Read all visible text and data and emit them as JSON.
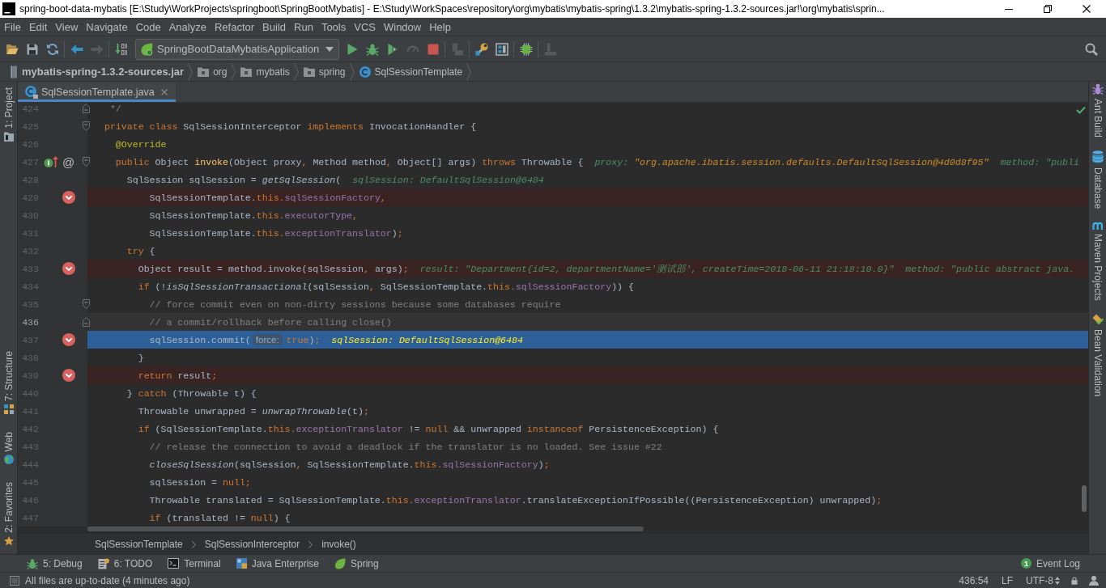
{
  "window": {
    "title": "spring-boot-data-mybatis [E:\\Study\\WorkProjects\\springboot\\SpringBootMybatis] - E:\\Study\\WorkSpaces\\repository\\org\\mybatis\\mybatis-spring\\1.3.2\\mybatis-spring-1.3.2-sources.jar!\\org\\mybatis\\sprin..."
  },
  "menu": [
    "File",
    "Edit",
    "View",
    "Navigate",
    "Code",
    "Analyze",
    "Refactor",
    "Build",
    "Run",
    "Tools",
    "VCS",
    "Window",
    "Help"
  ],
  "toolbar": {
    "run_configuration": "SpringBootDataMybatisApplication"
  },
  "navigation_bar": [
    {
      "label": "mybatis-spring-1.3.2-sources.jar",
      "kind": "jar"
    },
    {
      "label": "org",
      "kind": "package"
    },
    {
      "label": "mybatis",
      "kind": "package"
    },
    {
      "label": "spring",
      "kind": "package"
    },
    {
      "label": "SqlSessionTemplate",
      "kind": "class"
    }
  ],
  "left_strip": {
    "top": [
      {
        "label": "1: Project",
        "kind": "project"
      }
    ],
    "bottom": [
      {
        "label": "7: Structure",
        "kind": "structure"
      },
      {
        "label": "Web",
        "kind": "web"
      },
      {
        "label": "2: Favorites",
        "kind": "favorites"
      }
    ]
  },
  "right_strip": [
    {
      "label": "Ant Build",
      "kind": "ant"
    },
    {
      "label": "Database",
      "kind": "database"
    },
    {
      "label": "Maven Projects",
      "kind": "maven"
    },
    {
      "label": "Bean Validation",
      "kind": "bean"
    }
  ],
  "editor_tabs": [
    {
      "label": "SqlSessionTemplate.java",
      "selected": true
    }
  ],
  "editor": {
    "lines": [
      {
        "number": "424",
        "breakpoint": false,
        "current": false,
        "caret": false,
        "fold": {
          "kind": "end"
        },
        "code": [
          {
            "kind": "comment",
            "text": "   */"
          }
        ]
      },
      {
        "number": "425",
        "breakpoint": false,
        "current": false,
        "caret": false,
        "fold": {
          "kind": "start"
        },
        "code": [
          {
            "kind": "keyword",
            "text": "  private class"
          },
          {
            "kind": "plain",
            "text": " SqlSessionInterceptor "
          },
          {
            "kind": "keyword",
            "text": "implements"
          },
          {
            "kind": "plain",
            "text": " InvocationHandler {"
          }
        ]
      },
      {
        "number": "426",
        "breakpoint": false,
        "current": false,
        "caret": false,
        "code": [
          {
            "kind": "annotation",
            "text": "    @Override"
          }
        ]
      },
      {
        "number": "427",
        "breakpoint": false,
        "current": false,
        "caret": false,
        "fold": {
          "kind": "start"
        },
        "gutter_icon": {
          "kind": "implements"
        },
        "gutter_glyph": "@",
        "code": [
          {
            "kind": "keyword",
            "text": "    public"
          },
          {
            "kind": "plain",
            "text": " Object "
          },
          {
            "kind": "declaration",
            "text": "invoke"
          },
          {
            "kind": "plain",
            "text": "(Object proxy"
          },
          {
            "kind": "keyword",
            "text": ","
          },
          {
            "kind": "plain",
            "text": " Method method"
          },
          {
            "kind": "keyword",
            "text": ","
          },
          {
            "kind": "plain",
            "text": " Object[] args) "
          },
          {
            "kind": "keyword",
            "text": "throws"
          },
          {
            "kind": "plain",
            "text": " Throwable {"
          }
        ],
        "inline_values": [
          {
            "label": "proxy:",
            "value": "\"org.apache.ibatis.session.defaults.DefaultSqlSession@4d0d8f95\"",
            "changed": true
          },
          {
            "label": "method:",
            "value": "\"publi",
            "changed": false
          }
        ]
      },
      {
        "number": "428",
        "breakpoint": false,
        "current": false,
        "caret": false,
        "code": [
          {
            "kind": "plain",
            "text": "      SqlSession sqlSession = "
          },
          {
            "kind": "static",
            "text": "getSqlSession"
          },
          {
            "kind": "plain",
            "text": "("
          }
        ],
        "inline_values": [
          {
            "label": "sqlSession:",
            "value": "DefaultSqlSession@6484",
            "changed": false
          }
        ]
      },
      {
        "number": "429",
        "breakpoint": true,
        "current": false,
        "caret": false,
        "code": [
          {
            "kind": "plain",
            "text": "          SqlSessionTemplate."
          },
          {
            "kind": "keyword",
            "text": "this."
          },
          {
            "kind": "field",
            "text": "sqlSessionFactory"
          },
          {
            "kind": "keyword",
            "text": ","
          }
        ]
      },
      {
        "number": "430",
        "breakpoint": false,
        "current": false,
        "caret": false,
        "code": [
          {
            "kind": "plain",
            "text": "          SqlSessionTemplate."
          },
          {
            "kind": "keyword",
            "text": "this."
          },
          {
            "kind": "field",
            "text": "executorType"
          },
          {
            "kind": "keyword",
            "text": ","
          }
        ]
      },
      {
        "number": "431",
        "breakpoint": false,
        "current": false,
        "caret": false,
        "code": [
          {
            "kind": "plain",
            "text": "          SqlSessionTemplate."
          },
          {
            "kind": "keyword",
            "text": "this."
          },
          {
            "kind": "field",
            "text": "exceptionTranslator"
          },
          {
            "kind": "plain",
            "text": ")"
          },
          {
            "kind": "keyword",
            "text": ";"
          }
        ]
      },
      {
        "number": "432",
        "breakpoint": false,
        "current": false,
        "caret": false,
        "code": [
          {
            "kind": "keyword",
            "text": "      try"
          },
          {
            "kind": "plain",
            "text": " {"
          }
        ]
      },
      {
        "number": "433",
        "breakpoint": true,
        "current": false,
        "caret": false,
        "code": [
          {
            "kind": "plain",
            "text": "        Object result = method.invoke(sqlSession"
          },
          {
            "kind": "keyword",
            "text": ","
          },
          {
            "kind": "plain",
            "text": " args)"
          },
          {
            "kind": "keyword",
            "text": ";"
          }
        ],
        "inline_values": [
          {
            "label": "result:",
            "value": "\"Department{id=2, departmentName='测试部', createTime=2018-06-11 21:18:10.0}\"",
            "changed": false
          },
          {
            "label": "method:",
            "value": "\"public abstract java.",
            "changed": false
          }
        ]
      },
      {
        "number": "434",
        "breakpoint": false,
        "current": false,
        "caret": false,
        "code": [
          {
            "kind": "keyword",
            "text": "        if"
          },
          {
            "kind": "plain",
            "text": " (!"
          },
          {
            "kind": "static",
            "text": "isSqlSessionTransactional"
          },
          {
            "kind": "plain",
            "text": "(sqlSession"
          },
          {
            "kind": "keyword",
            "text": ","
          },
          {
            "kind": "plain",
            "text": " SqlSessionTemplate."
          },
          {
            "kind": "keyword",
            "text": "this."
          },
          {
            "kind": "field",
            "text": "sqlSessionFactory"
          },
          {
            "kind": "plain",
            "text": ")) {"
          }
        ]
      },
      {
        "number": "435",
        "breakpoint": false,
        "current": false,
        "caret": false,
        "fold": {
          "kind": "start"
        },
        "code": [
          {
            "kind": "comment",
            "text": "          // force commit even on non-dirty sessions because some databases require"
          }
        ]
      },
      {
        "number": "436",
        "breakpoint": false,
        "current": false,
        "caret": true,
        "fold": {
          "kind": "end"
        },
        "code": [
          {
            "kind": "comment",
            "text": "          // a commit/rollback before calling close()"
          }
        ]
      },
      {
        "number": "437",
        "breakpoint": true,
        "current": true,
        "caret": false,
        "code": [
          {
            "kind": "plain",
            "text": "          sqlSession.commit("
          },
          {
            "kind": "param-hint",
            "text": "force:"
          },
          {
            "kind": "keyword",
            "text": "true"
          },
          {
            "kind": "plain",
            "text": ")"
          },
          {
            "kind": "keyword",
            "text": ";"
          }
        ],
        "inline_values": [
          {
            "label": "sqlSession:",
            "value": "DefaultSqlSession@6484",
            "changed": false
          }
        ]
      },
      {
        "number": "438",
        "breakpoint": false,
        "current": false,
        "caret": false,
        "code": [
          {
            "kind": "plain",
            "text": "        }"
          }
        ]
      },
      {
        "number": "439",
        "breakpoint": true,
        "current": false,
        "caret": false,
        "code": [
          {
            "kind": "keyword",
            "text": "        return"
          },
          {
            "kind": "plain",
            "text": " result"
          },
          {
            "kind": "keyword",
            "text": ";"
          }
        ]
      },
      {
        "number": "440",
        "breakpoint": false,
        "current": false,
        "caret": false,
        "code": [
          {
            "kind": "plain",
            "text": "      } "
          },
          {
            "kind": "keyword",
            "text": "catch"
          },
          {
            "kind": "plain",
            "text": " (Throwable t) {"
          }
        ]
      },
      {
        "number": "441",
        "breakpoint": false,
        "current": false,
        "caret": false,
        "code": [
          {
            "kind": "plain",
            "text": "        Throwable unwrapped = "
          },
          {
            "kind": "static",
            "text": "unwrapThrowable"
          },
          {
            "kind": "plain",
            "text": "(t)"
          },
          {
            "kind": "keyword",
            "text": ";"
          }
        ]
      },
      {
        "number": "442",
        "breakpoint": false,
        "current": false,
        "caret": false,
        "code": [
          {
            "kind": "keyword",
            "text": "        if"
          },
          {
            "kind": "plain",
            "text": " (SqlSessionTemplate."
          },
          {
            "kind": "keyword",
            "text": "this."
          },
          {
            "kind": "field",
            "text": "exceptionTranslator"
          },
          {
            "kind": "plain",
            "text": " != "
          },
          {
            "kind": "keyword",
            "text": "null"
          },
          {
            "kind": "plain",
            "text": " && unwrapped "
          },
          {
            "kind": "keyword",
            "text": "instanceof"
          },
          {
            "kind": "plain",
            "text": " PersistenceException) {"
          }
        ]
      },
      {
        "number": "443",
        "breakpoint": false,
        "current": false,
        "caret": false,
        "code": [
          {
            "kind": "comment",
            "text": "          // release the connection to avoid a deadlock if the translator is no loaded. See issue #22"
          }
        ]
      },
      {
        "number": "444",
        "breakpoint": false,
        "current": false,
        "caret": false,
        "code": [
          {
            "kind": "static",
            "text": "          closeSqlSession"
          },
          {
            "kind": "plain",
            "text": "(sqlSession"
          },
          {
            "kind": "keyword",
            "text": ","
          },
          {
            "kind": "plain",
            "text": " SqlSessionTemplate."
          },
          {
            "kind": "keyword",
            "text": "this."
          },
          {
            "kind": "field",
            "text": "sqlSessionFactory"
          },
          {
            "kind": "plain",
            "text": ")"
          },
          {
            "kind": "keyword",
            "text": ";"
          }
        ]
      },
      {
        "number": "445",
        "breakpoint": false,
        "current": false,
        "caret": false,
        "code": [
          {
            "kind": "plain",
            "text": "          sqlSession = "
          },
          {
            "kind": "keyword",
            "text": "null;"
          }
        ]
      },
      {
        "number": "446",
        "breakpoint": false,
        "current": false,
        "caret": false,
        "code": [
          {
            "kind": "plain",
            "text": "          Throwable translated = SqlSessionTemplate."
          },
          {
            "kind": "keyword",
            "text": "this."
          },
          {
            "kind": "field",
            "text": "exceptionTranslator"
          },
          {
            "kind": "plain",
            "text": ".translateExceptionIfPossible((PersistenceException) unwrapped)"
          },
          {
            "kind": "keyword",
            "text": ";"
          }
        ]
      },
      {
        "number": "447",
        "breakpoint": false,
        "current": false,
        "caret": false,
        "code": [
          {
            "kind": "keyword",
            "text": "          if"
          },
          {
            "kind": "plain",
            "text": " (translated != "
          },
          {
            "kind": "keyword",
            "text": "null"
          },
          {
            "kind": "plain",
            "text": ") {"
          }
        ]
      }
    ]
  },
  "breadcrumbs": [
    "SqlSessionTemplate",
    "SqlSessionInterceptor",
    "invoke()"
  ],
  "tool_window_bar": {
    "left": [
      {
        "label": "5: Debug",
        "kind": "debug"
      },
      {
        "label": "6: TODO",
        "kind": "todo"
      },
      {
        "label": "Terminal",
        "kind": "terminal"
      },
      {
        "label": "Java Enterprise",
        "kind": "jee"
      },
      {
        "label": "Spring",
        "kind": "spring"
      }
    ],
    "right": [
      {
        "label": "Event Log",
        "count": "1"
      }
    ]
  },
  "status_bar": {
    "message": "All files are up-to-date (4 minutes ago)",
    "position": "436:54",
    "line_separator": "LF",
    "encoding": "UTF-8"
  }
}
